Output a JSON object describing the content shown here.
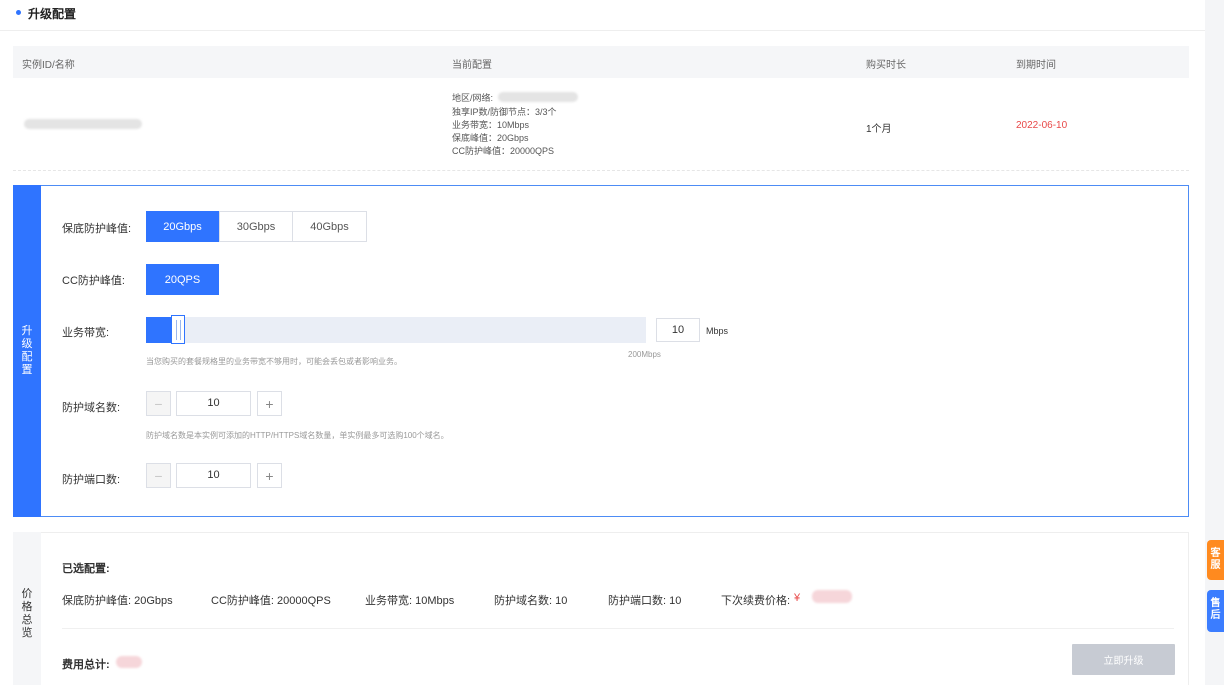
{
  "header": {
    "title": "升级配置"
  },
  "table": {
    "columns": [
      "实例ID/名称",
      "当前配置",
      "购买时长",
      "到期时间"
    ],
    "row": {
      "config_lines": [
        "地区/网络:",
        "独享IP数/防御节点：3/3个",
        "业务带宽：10Mbps",
        "保底峰值：20Gbps",
        "CC防护峰值：20000QPS"
      ],
      "duration": "1个月",
      "expiry": "2022-06-10"
    }
  },
  "upgrade": {
    "side_label": [
      "升",
      "级",
      "配",
      "置"
    ],
    "guarantee": {
      "label": "保底防护峰值:",
      "options": [
        "20Gbps",
        "30Gbps",
        "40Gbps"
      ],
      "selected": "20Gbps"
    },
    "cc": {
      "label": "CC防护峰值:",
      "options": [
        "20QPS"
      ],
      "selected": "20QPS"
    },
    "bandwidth": {
      "label": "业务带宽:",
      "value": "10",
      "unit": "Mbps",
      "max_label": "200Mbps",
      "slider_value": 10,
      "slider_max": 200,
      "hint": "当您购买的套餐规格里的业务带宽不够用时，可能会丢包或者影响业务。"
    },
    "domains": {
      "label": "防护域名数:",
      "value": "10",
      "hint": "防护域名数是本实例可添加的HTTP/HTTPS域名数量，单实例最多可选购100个域名。"
    },
    "ports": {
      "label": "防护端口数:",
      "value": "10"
    },
    "minus": "−",
    "plus": "+"
  },
  "price": {
    "side_label": [
      "价",
      "格",
      "总",
      "览"
    ],
    "selected_title": "已选配置:",
    "items": {
      "guarantee": "保底防护峰值: 20Gbps",
      "cc": "CC防护峰值: 20000QPS",
      "bandwidth": "业务带宽: 10Mbps",
      "domains": "防护域名数: 10",
      "ports": "防护端口数: 10",
      "renew": "下次续费价格:"
    },
    "currency": "¥",
    "total_label": "费用总计:",
    "buy_button": "立即升级"
  },
  "float_tabs": [
    {
      "label": "客服",
      "chars": [
        "客",
        "服"
      ],
      "color": "#ff8a1f"
    },
    {
      "label": "售后",
      "chars": [
        "售",
        "后"
      ],
      "color": "#3b7dff"
    }
  ]
}
